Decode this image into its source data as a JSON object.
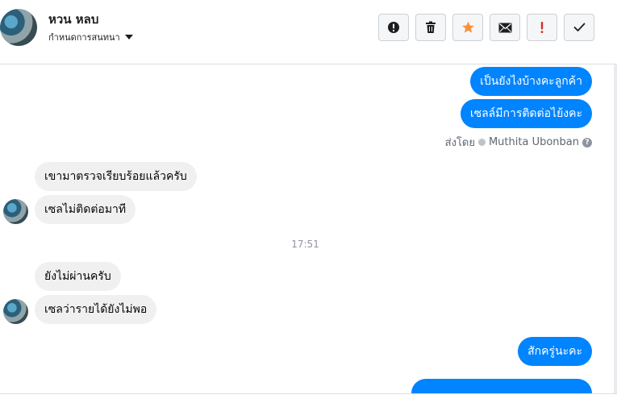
{
  "header": {
    "contact_name": "หวน หลบ",
    "set_topic_label": "กำหนดการสนทนา"
  },
  "toolbar": [
    {
      "icon": "exclamation-circle-icon"
    },
    {
      "icon": "trash-icon"
    },
    {
      "icon": "star-icon",
      "color": "#f7923b"
    },
    {
      "icon": "envelope-icon"
    },
    {
      "icon": "spam-exclamation-icon",
      "color": "#d62b2b"
    },
    {
      "icon": "check-icon"
    }
  ],
  "messages": {
    "out_1": "เป็นยังไงบ้างคะลูกค้า",
    "out_2": "เซลล์มีการติดต่อไย้งคะ",
    "sent_by_prefix": "ส่งโดย",
    "sent_by_name": "Muthita Ubonban",
    "in_1": "เขามาตรวจเรียบร้อยแล้วครับ",
    "in_2": "เซลไม่ติดต่อมาที",
    "timestamp": "17:51",
    "in_3": "ยังไม่ผ่านครับ",
    "in_4": "เซลว่ารายได้ยังไม่พอ",
    "out_3": "สักครู่นะคะ"
  },
  "colors": {
    "outgoing_bubble": "#0084ff",
    "incoming_bubble": "#f0f0f0"
  }
}
